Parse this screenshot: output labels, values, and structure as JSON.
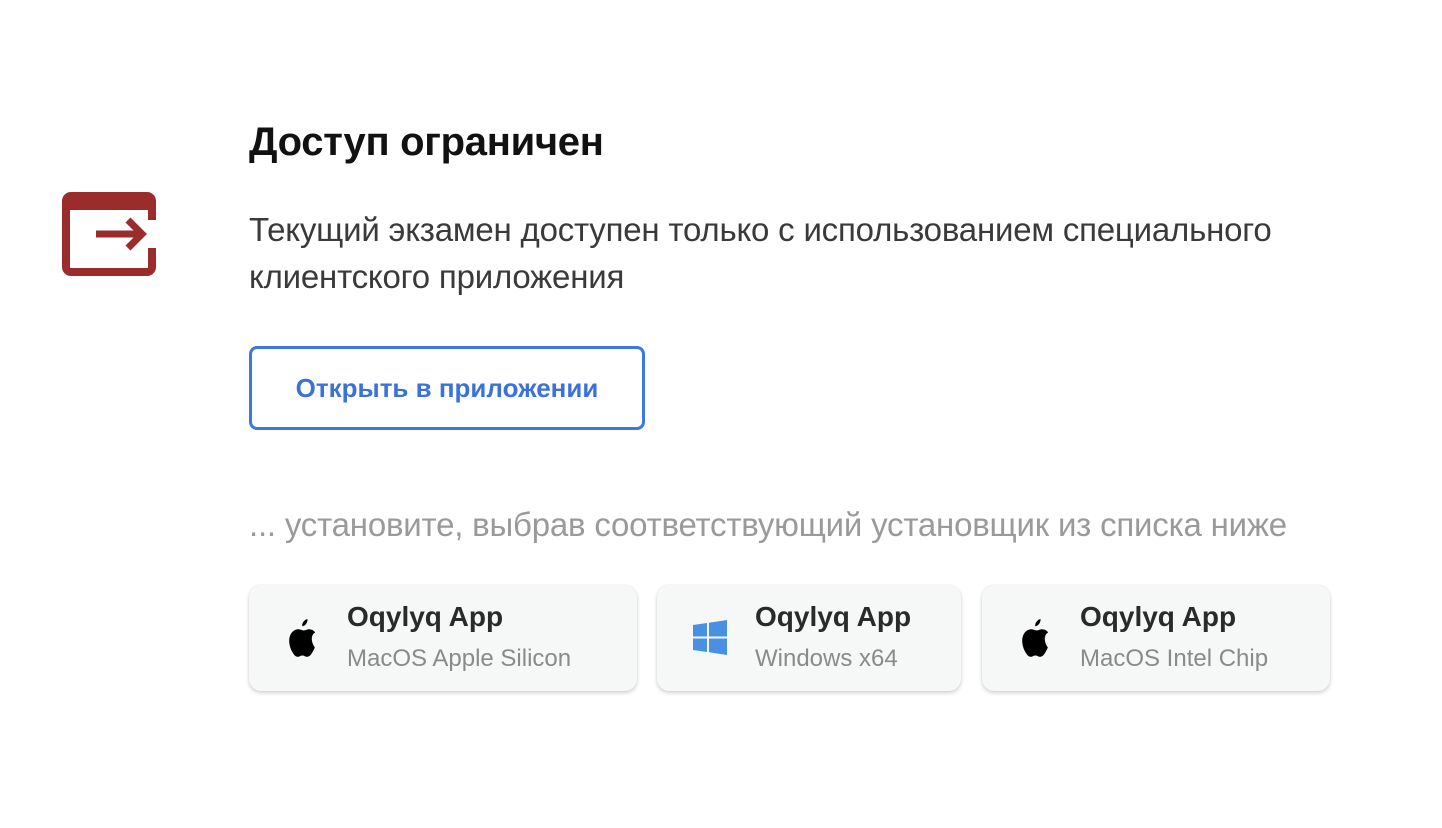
{
  "colors": {
    "icon_red": "#9b2c2c",
    "accent_blue": "#3b78e0",
    "windows_blue": "#4a90e2"
  },
  "notice": {
    "icon": "exit-to-app-icon",
    "title": "Доступ ограничен",
    "description": "Текущий экзамен доступен только с использованием специального клиентского приложения",
    "open_button_label": "Открыть в приложении"
  },
  "install_hint": "... установите, выбрав соответствующий установщик из списка ниже",
  "installers": [
    {
      "icon": "apple-icon",
      "title": "Oqylyq App",
      "subtitle": "MacOS Apple Silicon"
    },
    {
      "icon": "windows-icon",
      "title": "Oqylyq App",
      "subtitle": "Windows x64"
    },
    {
      "icon": "apple-icon",
      "title": "Oqylyq App",
      "subtitle": "MacOS Intel Chip"
    }
  ]
}
